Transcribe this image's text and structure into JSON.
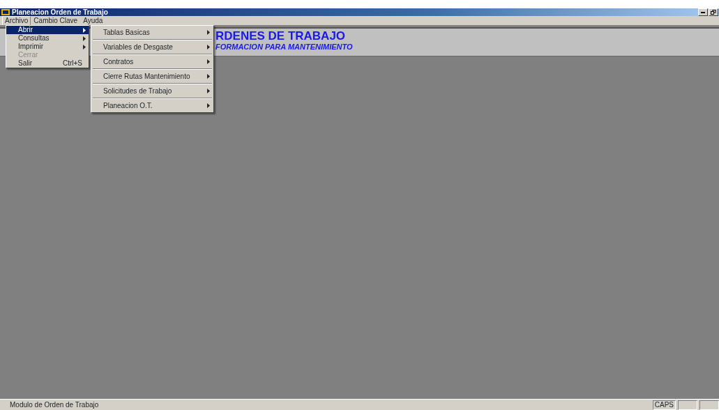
{
  "window": {
    "title": "Planeacion Orden de Trabajo"
  },
  "menu_bar": [
    {
      "label": "Archivo",
      "selected": true
    },
    {
      "label": "Cambio Clave",
      "selected": false
    },
    {
      "label": "Ayuda",
      "selected": false
    }
  ],
  "menu": [
    {
      "label": "Abrir",
      "submenu": true,
      "selected": true,
      "disabled": false
    },
    {
      "label": "Consultas",
      "submenu": true,
      "selected": false,
      "disabled": false
    },
    {
      "label": "Imprimir",
      "submenu": true,
      "selected": false,
      "disabled": false
    },
    {
      "label": "Cerrar",
      "submenu": false,
      "selected": false,
      "disabled": true
    },
    {
      "label": "Salir",
      "shortcut": "Ctrl+S",
      "submenu": false,
      "selected": false,
      "disabled": false
    }
  ],
  "submenu": [
    {
      "label": "Tablas Basicas",
      "submenu": true
    },
    {
      "label": "Variables de Desgaste",
      "submenu": true
    },
    {
      "label": "Contratos",
      "submenu": true
    },
    {
      "label": "Cierre Rutas Mantenimiento",
      "submenu": true
    },
    {
      "label": "Solicitudes de Trabajo",
      "submenu": true
    },
    {
      "label": "Planeacion O.T.",
      "submenu": true
    }
  ],
  "header": {
    "title": "RDENES DE TRABAJO",
    "subtitle": "FORMACION PARA MANTENIMIENTO"
  },
  "status_bar": {
    "text": "Modulo de Orden de Trabajo",
    "panels": [
      {
        "kind": "text",
        "text": "CAPS"
      },
      {
        "kind": "blank"
      },
      {
        "kind": "blank"
      }
    ]
  }
}
